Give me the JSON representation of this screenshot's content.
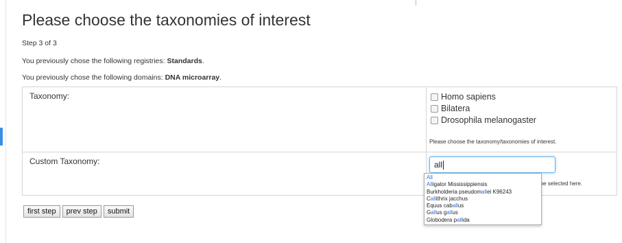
{
  "page": {
    "title": "Please choose the taxonomies of interest",
    "step": "Step 3 of 3",
    "registries_prefix": "You previously chose the following registries: ",
    "registries_value": "Standards",
    "domains_prefix": "You previously chose the following domains: ",
    "domains_value": "DNA microarray",
    "period": "."
  },
  "form": {
    "taxonomy_label": "Taxonomy:",
    "taxonomy_options": [
      "Homo sapiens",
      "Bilatera",
      "Drosophila melanogaster"
    ],
    "taxonomy_hint": "Please choose the taxonomy/taxonomies of interest.",
    "custom_label": "Custom Taxonomy:",
    "custom_value": "all",
    "custom_hint_partial": "ay be selected here.",
    "autocomplete": [
      {
        "pre": "",
        "match": "All",
        "post": ""
      },
      {
        "pre": "",
        "match": "All",
        "post": "igator Mississippiensis"
      },
      {
        "pre": "Burkholderia pseudom",
        "match": "all",
        "post": "ei K96243"
      },
      {
        "pre": "C",
        "match": "all",
        "post": "ithrix jacchus"
      },
      {
        "pre": "Equus cab",
        "match": "all",
        "post": "us"
      },
      {
        "pre": "G",
        "match": "all",
        "post": "us gallus",
        "extra": true
      },
      {
        "pre": "Globodera p",
        "match": "all",
        "post": "ida"
      }
    ]
  },
  "buttons": {
    "first": "first step",
    "prev": "prev step",
    "submit": "submit"
  }
}
